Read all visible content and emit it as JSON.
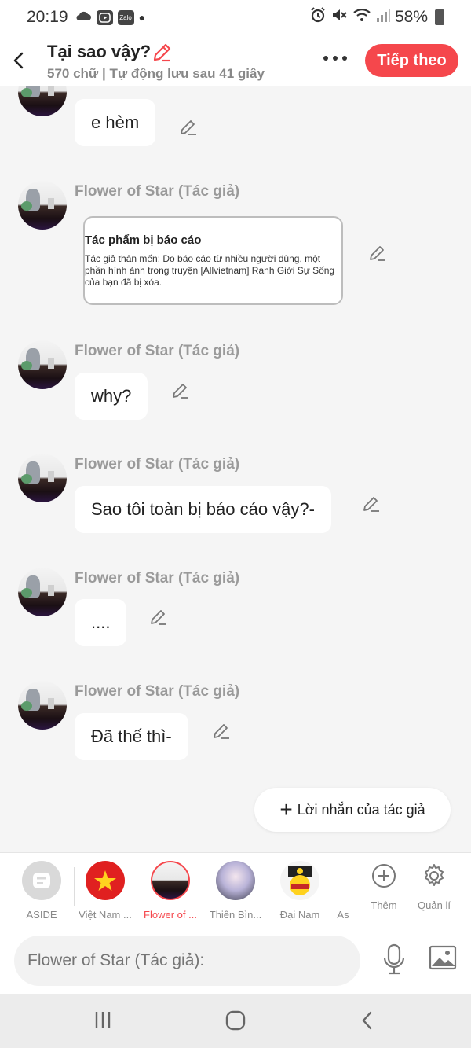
{
  "status_bar": {
    "time": "20:19",
    "zalo": "Zalo",
    "battery": "58%"
  },
  "header": {
    "title": "Tại sao vậy?",
    "subtitle": "570 chữ | Tự động lưu sau 41 giây",
    "next_label": "Tiếp theo"
  },
  "messages": [
    {
      "text": "e hèm"
    },
    {
      "sender": "Flower of Star (Tác giả)",
      "card_title": "Tác phẩm bị báo cáo",
      "card_body": "Tác giả thân mến: Do báo cáo từ nhiều người dùng, một phần hình ảnh trong truyện [Allvietnam] Ranh Giới Sự Sống của bạn đã bị xóa."
    },
    {
      "sender": "Flower of Star (Tác giả)",
      "text": "why?"
    },
    {
      "sender": "Flower of Star (Tác giả)",
      "text": "Sao tôi toàn bị báo cáo vậy?-"
    },
    {
      "sender": "Flower of Star (Tác giả)",
      "text": "...."
    },
    {
      "sender": "Flower of Star (Tác giả)",
      "text": "Đã thế thì-"
    }
  ],
  "author_note_button": "Lời nhắn của tác giả",
  "characters": [
    {
      "label": "ASIDE"
    },
    {
      "label": "Việt Nam ..."
    },
    {
      "label": "Flower of ..."
    },
    {
      "label": "Thiên Bìn..."
    },
    {
      "label": "Đại Nam"
    },
    {
      "label": "As"
    }
  ],
  "tools": {
    "add": "Thêm",
    "manage": "Quản lí"
  },
  "input": {
    "placeholder": "Flower of Star (Tác giả):"
  },
  "colors": {
    "accent": "#f5474c",
    "background": "#f5f5f5",
    "bubble": "#ffffff"
  }
}
